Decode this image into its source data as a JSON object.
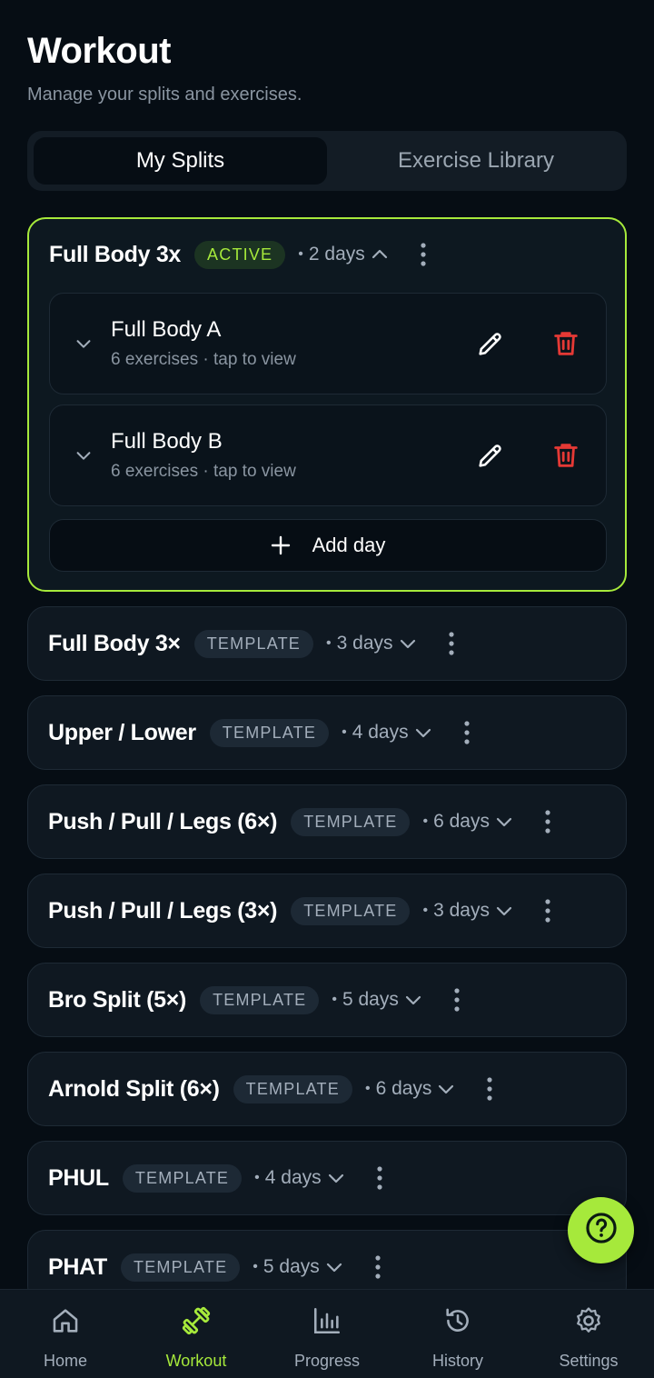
{
  "header": {
    "title": "Workout",
    "subtitle": "Manage your splits and exercises."
  },
  "tabs": [
    {
      "label": "My Splits",
      "active": true
    },
    {
      "label": "Exercise Library",
      "active": false
    }
  ],
  "active_split": {
    "name": "Full Body 3x",
    "badge": "ACTIVE",
    "days_label": "2 days",
    "days": [
      {
        "title": "Full Body A",
        "subtitle": "6 exercises · tap to view"
      },
      {
        "title": "Full Body B",
        "subtitle": "6 exercises · tap to view"
      }
    ],
    "add_day_label": "Add day"
  },
  "templates": [
    {
      "name": "Full Body 3×",
      "badge": "TEMPLATE",
      "days_label": "3 days"
    },
    {
      "name": "Upper / Lower",
      "badge": "TEMPLATE",
      "days_label": "4 days"
    },
    {
      "name": "Push / Pull / Legs (6×)",
      "badge": "TEMPLATE",
      "days_label": "6 days"
    },
    {
      "name": "Push / Pull / Legs (3×)",
      "badge": "TEMPLATE",
      "days_label": "3 days"
    },
    {
      "name": "Bro Split (5×)",
      "badge": "TEMPLATE",
      "days_label": "5 days"
    },
    {
      "name": "Arnold Split (6×)",
      "badge": "TEMPLATE",
      "days_label": "6 days"
    },
    {
      "name": "PHUL",
      "badge": "TEMPLATE",
      "days_label": "4 days"
    },
    {
      "name": "PHAT",
      "badge": "TEMPLATE",
      "days_label": "5 days"
    }
  ],
  "fab": {
    "icon": "help-icon"
  },
  "bottom_nav": [
    {
      "label": "Home",
      "icon": "home-icon",
      "active": false
    },
    {
      "label": "Workout",
      "icon": "dumbbell-icon",
      "active": true
    },
    {
      "label": "Progress",
      "icon": "bar-chart-icon",
      "active": false
    },
    {
      "label": "History",
      "icon": "history-icon",
      "active": false
    },
    {
      "label": "Settings",
      "icon": "gear-icon",
      "active": false
    }
  ],
  "colors": {
    "background": "#060d14",
    "card": "#0f1821",
    "accent": "#a6e93b",
    "danger": "#e53935",
    "muted_text": "#a3aebb"
  }
}
